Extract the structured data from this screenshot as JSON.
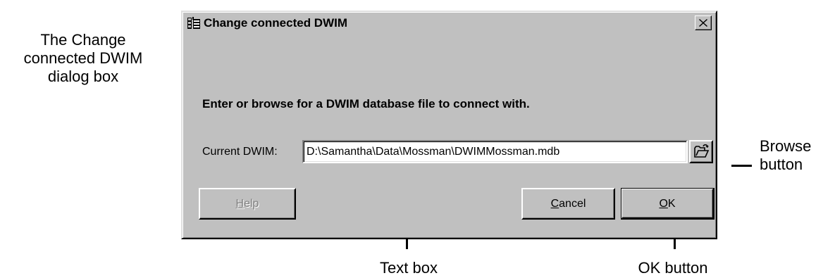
{
  "callouts": {
    "dialog": [
      "The Change",
      "connected DWIM",
      "dialog box"
    ],
    "browse": [
      "Browse",
      "button"
    ],
    "textbox": "Text box",
    "ok": "OK button"
  },
  "dialog": {
    "title": "Change connected DWIM",
    "title_icon": "app-icon",
    "close_icon": "close-icon",
    "instruction": "Enter or browse for a DWIM database file to connect with.",
    "field_label": "Current DWIM:",
    "field_value": "D:\\Samantha\\Data\\Mossman\\DWIMMossman.mdb",
    "browse_icon": "open-folder-icon",
    "buttons": {
      "help": {
        "mnemonic": "H",
        "rest": "elp",
        "enabled": false
      },
      "cancel": {
        "mnemonic": "C",
        "rest": "ancel",
        "enabled": true
      },
      "ok": {
        "mnemonic": "O",
        "rest": "K",
        "enabled": true,
        "default": true
      }
    }
  },
  "colors": {
    "dialog_face": "#c0c0c0",
    "text": "#000000",
    "disabled_text": "#808080",
    "field_bg": "#ffffff"
  }
}
